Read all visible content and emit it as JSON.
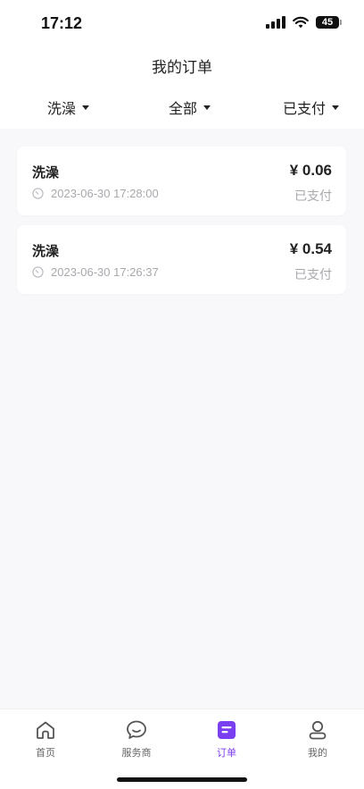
{
  "status_bar": {
    "time": "17:12",
    "battery": "45"
  },
  "header": {
    "title": "我的订单"
  },
  "filters": [
    {
      "label": "洗澡"
    },
    {
      "label": "全部"
    },
    {
      "label": "已支付"
    }
  ],
  "orders": [
    {
      "title": "洗澡",
      "amount": "¥ 0.06",
      "time": "2023-06-30 17:28:00",
      "status": "已支付"
    },
    {
      "title": "洗澡",
      "amount": "¥ 0.54",
      "time": "2023-06-30 17:26:37",
      "status": "已支付"
    }
  ],
  "tabbar": {
    "items": [
      {
        "label": "首页",
        "icon": "home-icon"
      },
      {
        "label": "服务商",
        "icon": "chat-bubble-icon"
      },
      {
        "label": "订单",
        "icon": "order-icon",
        "active": true
      },
      {
        "label": "我的",
        "icon": "profile-icon"
      }
    ],
    "active_color": "#7b3ff2"
  }
}
